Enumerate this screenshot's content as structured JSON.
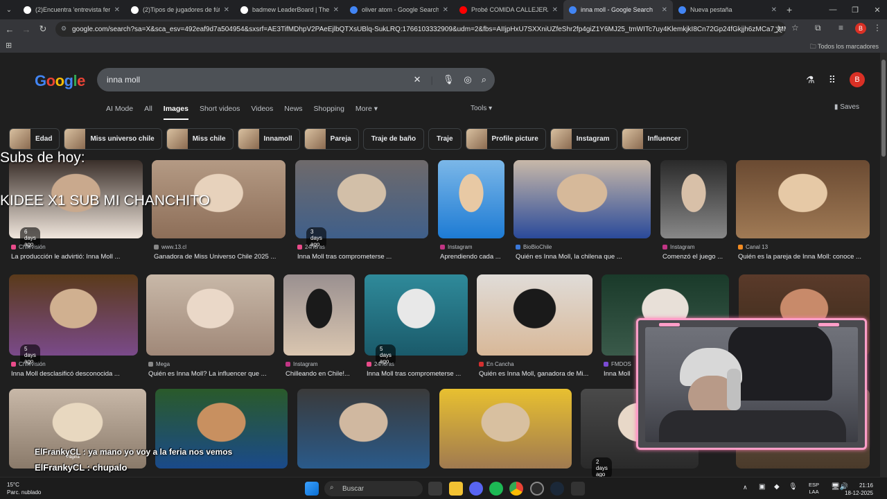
{
  "tabs": [
    {
      "title": "(2)Encuentra 'entrevista feria of",
      "fav_color": "#ffffff"
    },
    {
      "title": "(2)Tipos de jugadores de fútbol",
      "fav_color": "#ffffff"
    },
    {
      "title": "badmew LeaderBoard | The be",
      "fav_color": "#ffffff"
    },
    {
      "title": "oliver atom - Google Search",
      "fav_color": "#4285f4"
    },
    {
      "title": "Probé COMIDA CALLEJERA en",
      "fav_color": "#ff0000"
    },
    {
      "title": "inna moll - Google Search",
      "fav_color": "#4285f4",
      "active": true
    },
    {
      "title": "Nueva pestaña",
      "fav_color": "#4285f4"
    }
  ],
  "address": {
    "url": "google.com/search?sa=X&sca_esv=492eaf9d7a504954&sxsrf=AE3TifMDhpV2PAeEjlbQTXsUBlq-SukLRQ:1766103332909&udm=2&fbs=AIIjpHxU7SXXniUZfeShr2fp4giZ1Y6MJ25_tmWITc7uy4KlemkjkI8Cn72Gp24fGkjjh6zMCa7_MMjQ9iBkHsfpW..."
  },
  "bookmarks": {
    "all_label": "Todos los marcadores"
  },
  "avatar_letter": "B",
  "search": {
    "query": "inna moll",
    "logo_text": "Google"
  },
  "nav_tabs": [
    "AI Mode",
    "All",
    "Images",
    "Short videos",
    "Videos",
    "News",
    "Shopping",
    "More ▾"
  ],
  "active_tab": "Images",
  "tools_label": "Tools ▾",
  "saves_label": "Saves",
  "chips": [
    {
      "label": "Edad",
      "thumb": true
    },
    {
      "label": "Miss universo chile",
      "thumb": true
    },
    {
      "label": "Miss chile",
      "thumb": true
    },
    {
      "label": "Innamoll",
      "thumb": true
    },
    {
      "label": "Pareja",
      "thumb": true
    },
    {
      "label": "Traje de baño",
      "thumb": false
    },
    {
      "label": "Traje",
      "thumb": false
    },
    {
      "label": "Profile picture",
      "thumb": true
    },
    {
      "label": "Instagram",
      "thumb": true
    },
    {
      "label": "Influencer",
      "thumb": true
    }
  ],
  "row1": [
    {
      "badge": "6 days ago",
      "source": "Chilevisión",
      "caption": "La producción le advirtió: Inna Moll ...",
      "src_color": "#e94b8a",
      "colors": [
        "#3a2f2a",
        "#c9a98d",
        "#f0e6dc"
      ]
    },
    {
      "badge": "",
      "source": "www.13.cl",
      "caption": "Ganadora de Miss Universo Chile 2025 ...",
      "src_color": "#888888",
      "colors": [
        "#b49a84",
        "#e7d2bc",
        "#8d6e58"
      ]
    },
    {
      "badge": "3 days ago",
      "source": "24horas",
      "caption": "Inna Moll tras comprometerse ...",
      "src_color": "#e94b8a",
      "colors": [
        "#6f6a6b",
        "#d2bfa8",
        "#3f5f8a"
      ]
    },
    {
      "badge": "",
      "source": "Instagram",
      "caption": "Aprendiendo cada ...",
      "src_color": "#c13584",
      "colors": [
        "#7bb7e8",
        "#e8c9a4",
        "#1d7bd4"
      ]
    },
    {
      "badge": "",
      "source": "BioBioChile",
      "caption": "Quién es Inna Moll, la chilena que ...",
      "src_color": "#3b78d8",
      "colors": [
        "#c8b8a8",
        "#d6b99a",
        "#2a4a9a"
      ]
    },
    {
      "badge": "",
      "source": "Instagram",
      "caption": "Comenzó el juego ...",
      "src_color": "#c13584",
      "colors": [
        "#2a2a2a",
        "#d8c0a8",
        "#888888"
      ]
    },
    {
      "badge": "",
      "source": "Canal 13",
      "caption": "Quién es la pareja de Inna Moll: conoce ...",
      "src_color": "#f28b22",
      "colors": [
        "#6a4a32",
        "#e6c9a6",
        "#a07a55"
      ]
    }
  ],
  "row2": [
    {
      "badge": "5 days ago",
      "source": "Chilevisión",
      "caption": "Inna Moll desclasificó desconocida ...",
      "src_color": "#e94b8a",
      "colors": [
        "#5a3a1a",
        "#d0b090",
        "#7a4a8a"
      ]
    },
    {
      "badge": "",
      "source": "Mega",
      "caption": "Quién es Inna Moll? La influencer que ...",
      "src_color": "#888888",
      "colors": [
        "#c8b8a8",
        "#ead8c8",
        "#a08878"
      ]
    },
    {
      "badge": "",
      "source": "Instagram",
      "caption": "Chilleando en Chile!...",
      "src_color": "#c13584",
      "colors": [
        "#9a9090",
        "#1a1a1a",
        "#dac6b0"
      ]
    },
    {
      "badge": "5 days ago",
      "source": "24horas",
      "caption": "Inna Moll tras comprometerse ...",
      "src_color": "#e94b8a",
      "colors": [
        "#2f8a9a",
        "#e8e8e8",
        "#1a5a6a"
      ]
    },
    {
      "badge": "",
      "source": "En Cancha",
      "caption": "Quién es Inna Moll, ganadora de Mi...",
      "src_color": "#d32f2f",
      "colors": [
        "#e0dcd8",
        "#1a1a1a",
        "#d8b898"
      ]
    },
    {
      "badge": "",
      "source": "FMDOS",
      "caption": "Inna Moll",
      "src_color": "#7b4bd3",
      "colors": [
        "#1a3a2a",
        "#e8e0d8",
        "#3a5a4a"
      ]
    },
    {
      "badge": "",
      "source": "",
      "caption": "",
      "src_color": "#888888",
      "colors": [
        "#5a3a2a",
        "#c88a6a",
        "#3a2a1a"
      ]
    }
  ],
  "row3": [
    {
      "colors": [
        "#c8b8a8",
        "#e8d8c0",
        "#8a7a6a"
      ]
    },
    {
      "colors": [
        "#2a5a2a",
        "#c89060",
        "#1a4a8a"
      ]
    },
    {
      "colors": [
        "#3a3a3a",
        "#d0b8a0",
        "#2a5a8a"
      ]
    },
    {
      "colors": [
        "#e8c030",
        "#d8c0a0",
        "#a07a50"
      ]
    },
    {
      "badge": "2 days ago",
      "colors": [
        "#4a4a4a",
        "#e8d8c8",
        "#2a2a2a"
      ]
    },
    {
      "colors": [
        "#6a5a4a",
        "#b8a898",
        "#4a3a2a"
      ]
    }
  ],
  "stream_overlay": {
    "subs_title": "Subs de hoy:",
    "subs_entry": "KIDEE X1 SUB MI CHANCHITO",
    "chat1": "ElFrankyCL : ya mano yo voy a la feria nos vemos",
    "chat2": "ElFrankyCL : chupalo",
    "page_hint": "Página"
  },
  "taskbar": {
    "temp": "15°C",
    "weather": "Parc. nublado",
    "search_label": "Buscar",
    "lang1": "ESP",
    "lang2": "LAA",
    "time": "21:16",
    "date": "18-12-2025"
  }
}
